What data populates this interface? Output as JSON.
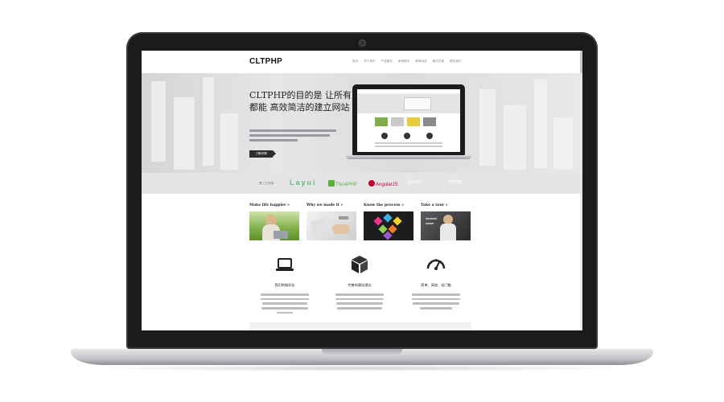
{
  "site": {
    "logo": "CLTPHP",
    "nav": [
      "首页",
      "关于我们",
      "产品服务",
      "案例展示",
      "新闻动态",
      "解决方案",
      "联系我们"
    ]
  },
  "hero": {
    "title": "CLTPHP的目的是 让所有人都能 高效简洁的建立网站",
    "button": "了解详情"
  },
  "partners": {
    "label": "第三方资源：",
    "items": [
      "Layui",
      "ThinkPHP",
      "AngularJS",
      "jQuery",
      "ztree"
    ]
  },
  "features": [
    {
      "title": "Make life happier »",
      "image": "person-laptop-photo"
    },
    {
      "title": "Why we made it »",
      "image": "hands-workspace-photo"
    },
    {
      "title": "Know the process »",
      "image": "colorful-cubes-photo"
    },
    {
      "title": "Take a tour »",
      "image": "woman-touch-screen-photo"
    }
  ],
  "services": [
    {
      "title": "我们的微异化",
      "icon": "laptop-icon"
    },
    {
      "title": "完善的建站理念",
      "icon": "cube-icon"
    },
    {
      "title": "简单、高效、低门槛",
      "icon": "speedometer-icon"
    }
  ],
  "colors": {
    "screen_bg": "#ffffff",
    "hero_bg": "#dcdcde",
    "partner_strip": "#e5e5e7",
    "button": "#2d2d2f",
    "laptop_frame": "#1b1b1d"
  }
}
